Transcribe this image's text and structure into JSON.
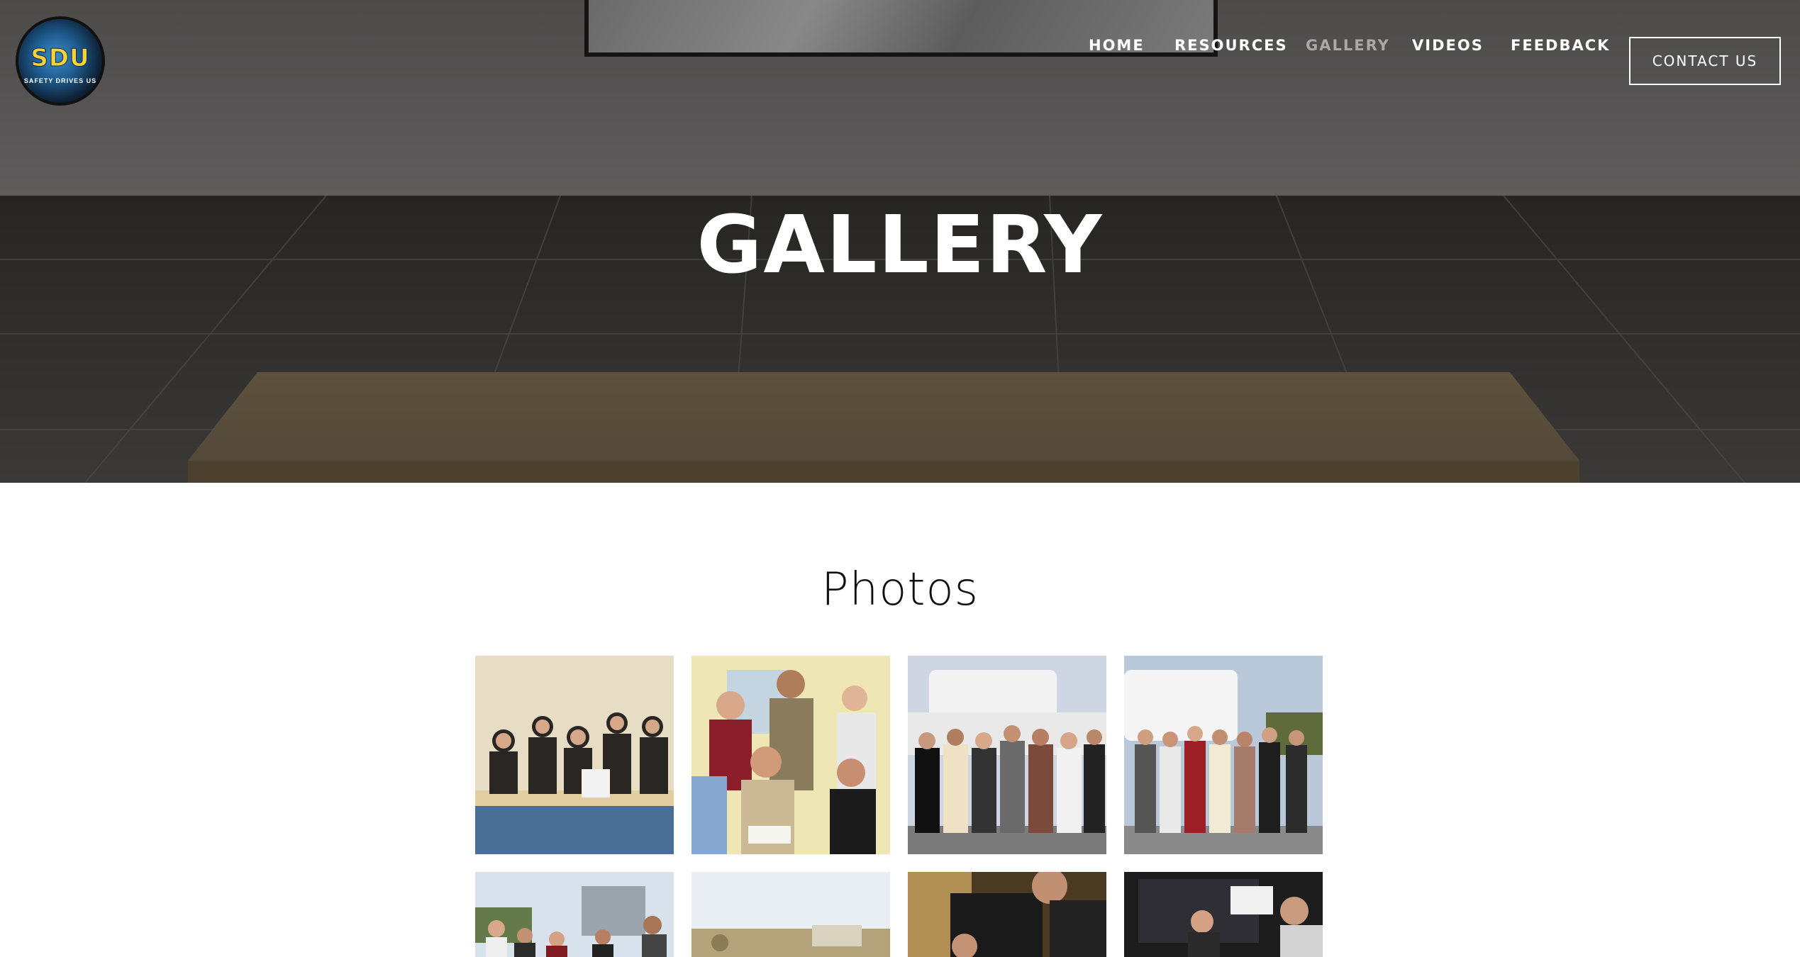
{
  "brand": {
    "logo_text": "SDU",
    "logo_tagline": "SAFETY DRIVES US"
  },
  "nav": {
    "items": [
      {
        "label": "HOME",
        "active": false
      },
      {
        "label": "RESOURCES",
        "active": false
      },
      {
        "label": "GALLERY",
        "active": true
      },
      {
        "label": "VIDEOS",
        "active": false
      },
      {
        "label": "FEEDBACK",
        "active": false
      }
    ],
    "contact_label": "CONTACT US"
  },
  "hero": {
    "title": "GALLERY"
  },
  "gallery": {
    "section_title": "Photos",
    "photos": [
      {
        "subject": "group-at-table"
      },
      {
        "subject": "group-portrait-indoor"
      },
      {
        "subject": "group-with-truck"
      },
      {
        "subject": "group-with-truck-2"
      },
      {
        "subject": "group-outdoors"
      },
      {
        "subject": "landscape-sky"
      },
      {
        "subject": "officer-closeup"
      },
      {
        "subject": "exhibit-booth"
      }
    ]
  },
  "colors": {
    "nav_text": "#ffffff",
    "nav_active": "#a9a9a9",
    "hero_overlay": "#3b3a39",
    "page_bg": "#ffffff"
  }
}
